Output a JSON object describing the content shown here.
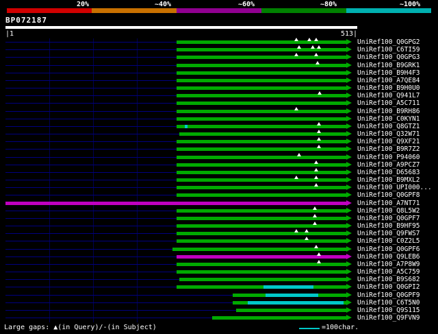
{
  "scale_bar": {
    "labels": [
      "20%",
      "~40%",
      "~60%",
      "~80%",
      "~100%"
    ],
    "segments": [
      {
        "from": 10,
        "to": 134,
        "color": "#d00000"
      },
      {
        "from": 134,
        "to": 258,
        "color": "#c87000"
      },
      {
        "from": 258,
        "to": 382,
        "color": "#900090"
      },
      {
        "from": 382,
        "to": 506,
        "color": "#008000"
      },
      {
        "from": 506,
        "to": 630,
        "color": "#00b0b0"
      }
    ]
  },
  "query": {
    "name": "BP072187",
    "ruler_start": "|1",
    "ruler_end": "513|"
  },
  "legend": {
    "gaps_text": "Large gaps: ▲(in Query)/-(in Subject)",
    "scale_text": "=100char."
  },
  "colors": {
    "green": "#00aa00",
    "magenta": "#c000c0",
    "cyan": "#00c8c8",
    "navy": "#000080"
  },
  "rows": [
    {
      "label": "UniRef100_Q0GPG2",
      "segments": [
        {
          "from": 258,
          "to": 506,
          "color": "green"
        }
      ],
      "arrow": "green",
      "triangles": [
        433,
        452,
        462
      ]
    },
    {
      "label": "UniRef100_C6TI59",
      "segments": [
        {
          "from": 258,
          "to": 506,
          "color": "green"
        }
      ],
      "arrow": "green",
      "triangles": [
        437,
        457,
        466
      ]
    },
    {
      "label": "UniRef100_Q0GPG3",
      "segments": [
        {
          "from": 258,
          "to": 506,
          "color": "green"
        }
      ],
      "arrow": "green",
      "triangles": [
        433,
        462
      ]
    },
    {
      "label": "UniRef100_B9GRK1",
      "segments": [
        {
          "from": 258,
          "to": 506,
          "color": "green"
        }
      ],
      "arrow": "green",
      "triangles": [
        464
      ]
    },
    {
      "label": "UniRef100_B9H4F3",
      "segments": [
        {
          "from": 258,
          "to": 506,
          "color": "green"
        }
      ],
      "arrow": "green",
      "triangles": []
    },
    {
      "label": "UniRef100_A7QE84",
      "segments": [
        {
          "from": 258,
          "to": 506,
          "color": "green"
        }
      ],
      "arrow": "green",
      "triangles": []
    },
    {
      "label": "UniRef100_B9H0U0",
      "segments": [
        {
          "from": 258,
          "to": 506,
          "color": "green"
        }
      ],
      "arrow": "green",
      "triangles": []
    },
    {
      "label": "UniRef100_Q941L7",
      "segments": [
        {
          "from": 258,
          "to": 506,
          "color": "green"
        }
      ],
      "arrow": "green",
      "triangles": [
        467
      ]
    },
    {
      "label": "UniRef100_A5C711",
      "segments": [
        {
          "from": 258,
          "to": 506,
          "color": "green"
        }
      ],
      "arrow": "green",
      "triangles": []
    },
    {
      "label": "UniRef100_B9RH86",
      "segments": [
        {
          "from": 258,
          "to": 506,
          "color": "green"
        }
      ],
      "arrow": "green",
      "triangles": [
        433
      ]
    },
    {
      "label": "UniRef100_C0KYN1",
      "segments": [
        {
          "from": 258,
          "to": 506,
          "color": "green"
        }
      ],
      "arrow": "green",
      "triangles": []
    },
    {
      "label": "UniRef100_Q8GTZ1",
      "segments": [
        {
          "from": 258,
          "to": 270,
          "color": "green"
        },
        {
          "from": 270,
          "to": 274,
          "color": "cyan"
        },
        {
          "from": 274,
          "to": 506,
          "color": "green"
        }
      ],
      "arrow": "green",
      "triangles": [
        466
      ]
    },
    {
      "label": "UniRef100_Q32W71",
      "segments": [
        {
          "from": 262,
          "to": 506,
          "color": "green"
        }
      ],
      "arrow": "green",
      "triangles": [
        466
      ]
    },
    {
      "label": "UniRef100_Q9XF21",
      "segments": [
        {
          "from": 258,
          "to": 506,
          "color": "green"
        }
      ],
      "arrow": "green",
      "triangles": [
        466
      ]
    },
    {
      "label": "UniRef100_B9R7Z2",
      "segments": [
        {
          "from": 258,
          "to": 506,
          "color": "green"
        }
      ],
      "arrow": "green",
      "triangles": [
        466
      ]
    },
    {
      "label": "UniRef100_P94060",
      "segments": [
        {
          "from": 258,
          "to": 506,
          "color": "green"
        }
      ],
      "arrow": "green",
      "triangles": [
        437
      ]
    },
    {
      "label": "UniRef100_A9PCZ7",
      "segments": [
        {
          "from": 258,
          "to": 506,
          "color": "green"
        }
      ],
      "arrow": "green",
      "triangles": [
        462
      ]
    },
    {
      "label": "UniRef100_D65683",
      "segments": [
        {
          "from": 258,
          "to": 506,
          "color": "green"
        }
      ],
      "arrow": "green",
      "triangles": [
        462
      ]
    },
    {
      "label": "UniRef100_B9MXL2",
      "segments": [
        {
          "from": 258,
          "to": 506,
          "color": "green"
        }
      ],
      "arrow": "green",
      "triangles": [
        433,
        462
      ]
    },
    {
      "label": "UniRef100_UPI000...",
      "segments": [
        {
          "from": 258,
          "to": 506,
          "color": "green"
        }
      ],
      "arrow": "green",
      "triangles": [
        462
      ]
    },
    {
      "label": "UniRef100_Q0GPF8",
      "segments": [
        {
          "from": 258,
          "to": 506,
          "color": "green"
        }
      ],
      "arrow": "green",
      "triangles": []
    },
    {
      "label": "UniRef100_A7NT71",
      "segments": [
        {
          "from": 8,
          "to": 506,
          "color": "magenta"
        }
      ],
      "arrow": "magenta",
      "triangles": []
    },
    {
      "label": "UniRef100_Q8L5W2",
      "segments": [
        {
          "from": 258,
          "to": 506,
          "color": "green"
        }
      ],
      "arrow": "green",
      "triangles": [
        460
      ]
    },
    {
      "label": "UniRef100_Q0GPF7",
      "segments": [
        {
          "from": 258,
          "to": 506,
          "color": "green"
        }
      ],
      "arrow": "green",
      "triangles": [
        460
      ]
    },
    {
      "label": "UniRef100_B9HF95",
      "segments": [
        {
          "from": 258,
          "to": 506,
          "color": "green"
        }
      ],
      "arrow": "green",
      "triangles": [
        460
      ]
    },
    {
      "label": "UniRef100_Q9FWS7",
      "segments": [
        {
          "from": 258,
          "to": 506,
          "color": "green"
        }
      ],
      "arrow": "green",
      "triangles": [
        433,
        448
      ]
    },
    {
      "label": "UniRef100_C0Z2L5",
      "segments": [
        {
          "from": 258,
          "to": 506,
          "color": "green"
        }
      ],
      "arrow": "green",
      "triangles": [
        448
      ]
    },
    {
      "label": "UniRef100_Q0GPF6",
      "segments": [
        {
          "from": 252,
          "to": 506,
          "color": "green"
        }
      ],
      "arrow": "green",
      "triangles": [
        462
      ]
    },
    {
      "label": "UniRef100_Q9LEB6",
      "segments": [
        {
          "from": 258,
          "to": 506,
          "color": "magenta"
        }
      ],
      "arrow": "magenta",
      "triangles": [
        466
      ]
    },
    {
      "label": "UniRef100_A7P8W9",
      "segments": [
        {
          "from": 258,
          "to": 506,
          "color": "green"
        }
      ],
      "arrow": "green",
      "triangles": [
        466
      ]
    },
    {
      "label": "UniRef100_A5C759",
      "segments": [
        {
          "from": 258,
          "to": 506,
          "color": "green"
        }
      ],
      "arrow": "green",
      "triangles": []
    },
    {
      "label": "UniRef100_B9S682",
      "segments": [
        {
          "from": 262,
          "to": 506,
          "color": "green"
        }
      ],
      "arrow": "green",
      "triangles": []
    },
    {
      "label": "UniRef100_Q0GPI2",
      "segments": [
        {
          "from": 258,
          "to": 385,
          "color": "green"
        },
        {
          "from": 385,
          "to": 458,
          "color": "cyan"
        },
        {
          "from": 458,
          "to": 506,
          "color": "green"
        }
      ],
      "arrow": "green",
      "triangles": []
    },
    {
      "label": "UniRef100_Q0GPF9",
      "segments": [
        {
          "from": 340,
          "to": 388,
          "color": "green"
        },
        {
          "from": 388,
          "to": 465,
          "color": "cyan"
        },
        {
          "from": 465,
          "to": 506,
          "color": "green"
        }
      ],
      "arrow": "green",
      "triangles": []
    },
    {
      "label": "UniRef100_C6T5N0",
      "segments": [
        {
          "from": 340,
          "to": 362,
          "color": "green"
        },
        {
          "from": 362,
          "to": 502,
          "color": "cyan"
        },
        {
          "from": 502,
          "to": 506,
          "color": "green"
        }
      ],
      "arrow": "green",
      "triangles": []
    },
    {
      "label": "UniRef100_Q9S115",
      "segments": [
        {
          "from": 345,
          "to": 506,
          "color": "green"
        }
      ],
      "arrow": "green",
      "triangles": []
    },
    {
      "label": "UniRef100_Q9FVN9",
      "segments": [
        {
          "from": 310,
          "to": 506,
          "color": "green"
        }
      ],
      "arrow": "green",
      "triangles": []
    }
  ]
}
